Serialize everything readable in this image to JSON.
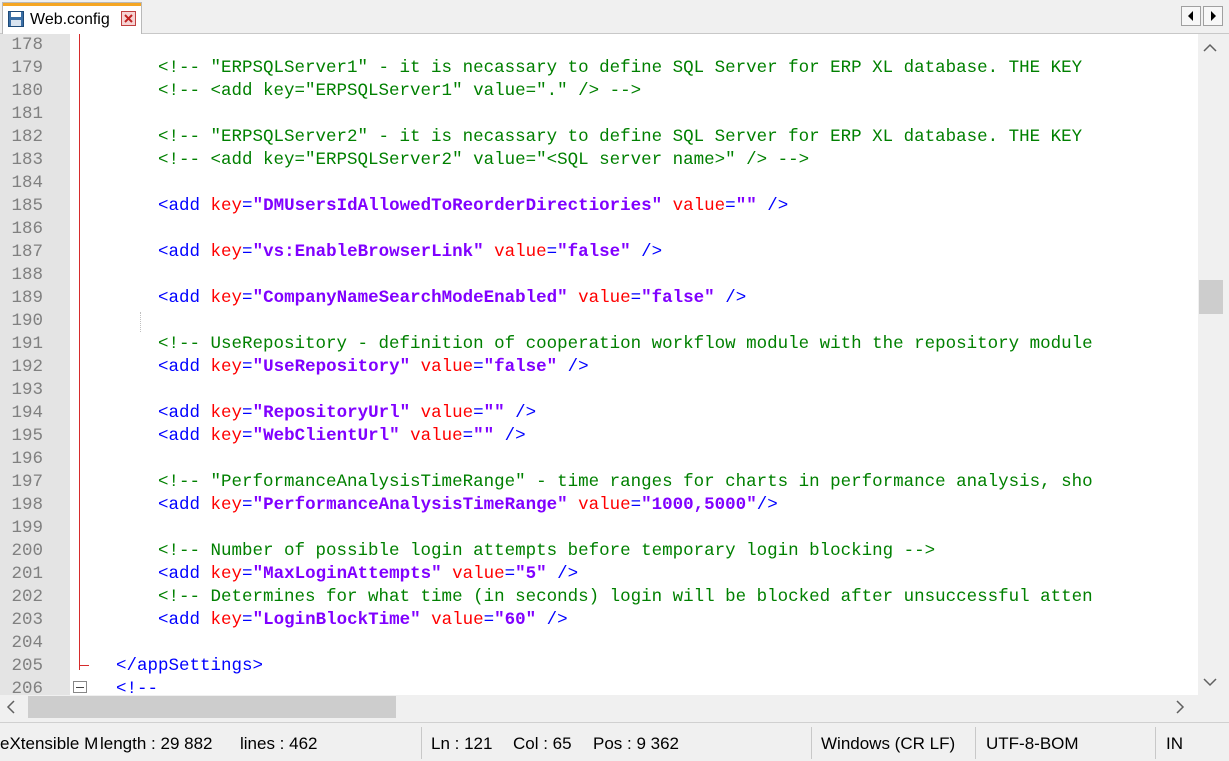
{
  "tab": {
    "title": "Web.config"
  },
  "colors": {
    "comment": "#008000",
    "tag": "#0000ff",
    "attr": "#ff0000",
    "value": "#8000ff",
    "line_number": "#808080",
    "fold_marker": "#d62b2b"
  },
  "icons": {
    "tab_save": "floppy-disk-icon",
    "tab_close": "close-icon",
    "nav_left": "chevron-left-icon",
    "nav_right": "chevron-right-icon"
  },
  "editor": {
    "lines": [
      {
        "n": "178",
        "s": []
      },
      {
        "n": "179",
        "s": [
          [
            "    ",
            ""
          ],
          [
            "<!-- \"ERPSQLServer1\" - it is necassary to define SQL Server for ERP XL database. THE KEY",
            "c-comment"
          ]
        ]
      },
      {
        "n": "180",
        "s": [
          [
            "    ",
            ""
          ],
          [
            "<!-- <add key=\"ERPSQLServer1\" value=\".\" /> -->",
            "c-comment"
          ]
        ]
      },
      {
        "n": "181",
        "s": []
      },
      {
        "n": "182",
        "s": [
          [
            "    ",
            ""
          ],
          [
            "<!-- \"ERPSQLServer2\" - it is necassary to define SQL Server for ERP XL database. THE KEY",
            "c-comment"
          ]
        ]
      },
      {
        "n": "183",
        "s": [
          [
            "    ",
            ""
          ],
          [
            "<!-- <add key=\"ERPSQLServer2\" value=\"<SQL server name>\" /> -->",
            "c-comment"
          ]
        ]
      },
      {
        "n": "184",
        "s": []
      },
      {
        "n": "185",
        "s": [
          [
            "    ",
            ""
          ],
          [
            "<add ",
            "c-tag"
          ],
          [
            "key",
            "c-attr"
          ],
          [
            "=",
            "c-tag"
          ],
          [
            "\"DMUsersIdAllowedToReorderDirectiories\"",
            "c-val"
          ],
          [
            " ",
            ""
          ],
          [
            "value",
            "c-attr"
          ],
          [
            "=",
            "c-tag"
          ],
          [
            "\"\"",
            "c-val"
          ],
          [
            " />",
            "c-tag"
          ]
        ]
      },
      {
        "n": "186",
        "s": []
      },
      {
        "n": "187",
        "s": [
          [
            "    ",
            ""
          ],
          [
            "<add ",
            "c-tag"
          ],
          [
            "key",
            "c-attr"
          ],
          [
            "=",
            "c-tag"
          ],
          [
            "\"vs:EnableBrowserLink\"",
            "c-val"
          ],
          [
            " ",
            ""
          ],
          [
            "value",
            "c-attr"
          ],
          [
            "=",
            "c-tag"
          ],
          [
            "\"false\"",
            "c-val"
          ],
          [
            " />",
            "c-tag"
          ]
        ]
      },
      {
        "n": "188",
        "s": []
      },
      {
        "n": "189",
        "s": [
          [
            "    ",
            ""
          ],
          [
            "<add ",
            "c-tag"
          ],
          [
            "key",
            "c-attr"
          ],
          [
            "=",
            "c-tag"
          ],
          [
            "\"CompanyNameSearchModeEnabled\"",
            "c-val"
          ],
          [
            " ",
            ""
          ],
          [
            "value",
            "c-attr"
          ],
          [
            "=",
            "c-tag"
          ],
          [
            "\"false\"",
            "c-val"
          ],
          [
            " />",
            "c-tag"
          ]
        ]
      },
      {
        "n": "190",
        "s": []
      },
      {
        "n": "191",
        "s": [
          [
            "    ",
            ""
          ],
          [
            "<!-- UseRepository - definition of cooperation workflow module with the repository module",
            "c-comment"
          ]
        ]
      },
      {
        "n": "192",
        "s": [
          [
            "    ",
            ""
          ],
          [
            "<add ",
            "c-tag"
          ],
          [
            "key",
            "c-attr"
          ],
          [
            "=",
            "c-tag"
          ],
          [
            "\"UseRepository\"",
            "c-val"
          ],
          [
            " ",
            ""
          ],
          [
            "value",
            "c-attr"
          ],
          [
            "=",
            "c-tag"
          ],
          [
            "\"false\"",
            "c-val"
          ],
          [
            " />",
            "c-tag"
          ]
        ]
      },
      {
        "n": "193",
        "s": []
      },
      {
        "n": "194",
        "s": [
          [
            "    ",
            ""
          ],
          [
            "<add ",
            "c-tag"
          ],
          [
            "key",
            "c-attr"
          ],
          [
            "=",
            "c-tag"
          ],
          [
            "\"RepositoryUrl\"",
            "c-val"
          ],
          [
            " ",
            ""
          ],
          [
            "value",
            "c-attr"
          ],
          [
            "=",
            "c-tag"
          ],
          [
            "\"\"",
            "c-val"
          ],
          [
            " />",
            "c-tag"
          ]
        ]
      },
      {
        "n": "195",
        "s": [
          [
            "    ",
            ""
          ],
          [
            "<add ",
            "c-tag"
          ],
          [
            "key",
            "c-attr"
          ],
          [
            "=",
            "c-tag"
          ],
          [
            "\"WebClientUrl\"",
            "c-val"
          ],
          [
            " ",
            ""
          ],
          [
            "value",
            "c-attr"
          ],
          [
            "=",
            "c-tag"
          ],
          [
            "\"\"",
            "c-val"
          ],
          [
            " />",
            "c-tag"
          ]
        ]
      },
      {
        "n": "196",
        "s": []
      },
      {
        "n": "197",
        "s": [
          [
            "    ",
            ""
          ],
          [
            "<!-- \"PerformanceAnalysisTimeRange\" - time ranges for charts in performance analysis, sho",
            "c-comment"
          ]
        ]
      },
      {
        "n": "198",
        "s": [
          [
            "    ",
            ""
          ],
          [
            "<add ",
            "c-tag"
          ],
          [
            "key",
            "c-attr"
          ],
          [
            "=",
            "c-tag"
          ],
          [
            "\"PerformanceAnalysisTimeRange\"",
            "c-val"
          ],
          [
            " ",
            ""
          ],
          [
            "value",
            "c-attr"
          ],
          [
            "=",
            "c-tag"
          ],
          [
            "\"1000,5000\"",
            "c-val"
          ],
          [
            "/>",
            "c-tag"
          ]
        ]
      },
      {
        "n": "199",
        "s": []
      },
      {
        "n": "200",
        "s": [
          [
            "    ",
            ""
          ],
          [
            "<!-- Number of possible login attempts before temporary login blocking -->",
            "c-comment"
          ]
        ]
      },
      {
        "n": "201",
        "s": [
          [
            "    ",
            ""
          ],
          [
            "<add ",
            "c-tag"
          ],
          [
            "key",
            "c-attr"
          ],
          [
            "=",
            "c-tag"
          ],
          [
            "\"MaxLoginAttempts\"",
            "c-val"
          ],
          [
            " ",
            ""
          ],
          [
            "value",
            "c-attr"
          ],
          [
            "=",
            "c-tag"
          ],
          [
            "\"5\"",
            "c-val"
          ],
          [
            " />",
            "c-tag"
          ]
        ]
      },
      {
        "n": "202",
        "s": [
          [
            "    ",
            ""
          ],
          [
            "<!-- Determines for what time (in seconds) login will be blocked after unsuccessful atten",
            "c-comment"
          ]
        ]
      },
      {
        "n": "203",
        "s": [
          [
            "    ",
            ""
          ],
          [
            "<add ",
            "c-tag"
          ],
          [
            "key",
            "c-attr"
          ],
          [
            "=",
            "c-tag"
          ],
          [
            "\"LoginBlockTime\"",
            "c-val"
          ],
          [
            " ",
            ""
          ],
          [
            "value",
            "c-attr"
          ],
          [
            "=",
            "c-tag"
          ],
          [
            "\"60\"",
            "c-val"
          ],
          [
            " />",
            "c-tag"
          ]
        ]
      },
      {
        "n": "204",
        "s": []
      },
      {
        "n": "205",
        "s": [
          [
            "</appSettings>",
            "c-tag"
          ]
        ]
      },
      {
        "n": "206",
        "s": [
          [
            "<!--",
            "c-tag"
          ]
        ]
      }
    ]
  },
  "status": {
    "language": "eXtensible M",
    "length": "length : 29 882",
    "lines": "lines : 462",
    "ln": "Ln : 121",
    "col": "Col : 65",
    "pos": "Pos : 9 362",
    "eol": "Windows (CR LF)",
    "encoding": "UTF-8-BOM",
    "mode": "IN"
  }
}
